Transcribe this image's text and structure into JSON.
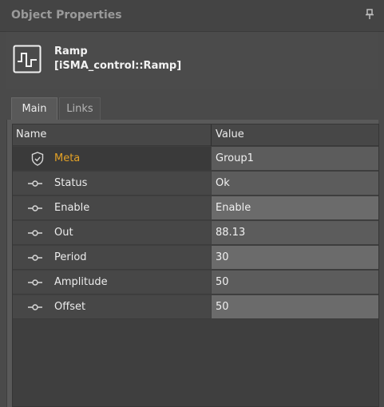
{
  "panel": {
    "title": "Object Properties",
    "pin_icon": "pin-icon"
  },
  "object": {
    "icon": "ramp-signal-icon",
    "name": "Ramp",
    "type": "[iSMA_control::Ramp]"
  },
  "tabs": [
    {
      "label": "Main",
      "active": true
    },
    {
      "label": "Links",
      "active": false
    }
  ],
  "grid": {
    "columns": {
      "name": "Name",
      "value": "Value"
    },
    "rows": [
      {
        "name": "Meta",
        "value": "Group1",
        "icon": "shield-check-icon"
      },
      {
        "name": "Status",
        "value": "Ok",
        "icon": "slot-connector-icon"
      },
      {
        "name": "Enable",
        "value": "Enable",
        "icon": "slot-connector-icon"
      },
      {
        "name": "Out",
        "value": "88.13",
        "icon": "slot-connector-icon"
      },
      {
        "name": "Period",
        "value": "30",
        "icon": "slot-connector-icon"
      },
      {
        "name": "Amplitude",
        "value": "50",
        "icon": "slot-connector-icon"
      },
      {
        "name": "Offset",
        "value": "50",
        "icon": "slot-connector-icon"
      }
    ]
  },
  "colors": {
    "meta_label": "#e3a126",
    "background": "#4a4a4a"
  }
}
